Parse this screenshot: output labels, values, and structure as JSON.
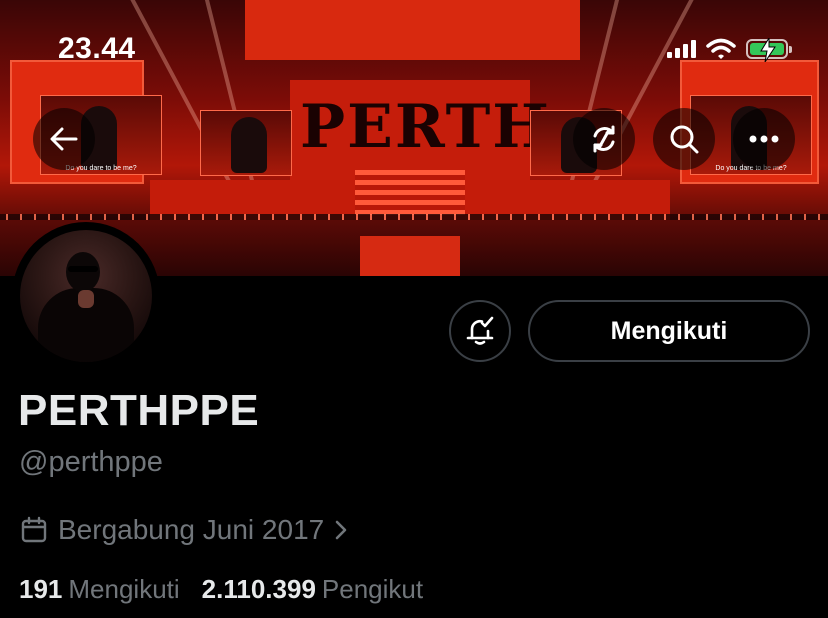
{
  "status_bar": {
    "time": "23.44"
  },
  "banner": {
    "stage_word": "PERTH",
    "screen_caption": "Do you dare to be me?"
  },
  "profile": {
    "display_name": "PERTHPPE",
    "handle": "@perthppe",
    "joined": "Bergabung Juni 2017",
    "follow_button_label": "Mengikuti",
    "following_count": "191",
    "following_label": "Mengikuti",
    "followers_count": "2.110.399",
    "followers_label": "Pengikut"
  },
  "icons": {
    "back": "arrow-left-icon",
    "translate": "circular-arrows-icon",
    "search": "search-icon",
    "more": "more-horizontal-icon",
    "notifications": "bell-check-icon",
    "calendar": "calendar-icon",
    "chevron": "chevron-right-icon"
  },
  "colors": {
    "background": "#000000",
    "primary_text": "#e7e9ea",
    "secondary_text": "#71767b",
    "button_border": "#3a3f45",
    "battery": "#34c759"
  }
}
